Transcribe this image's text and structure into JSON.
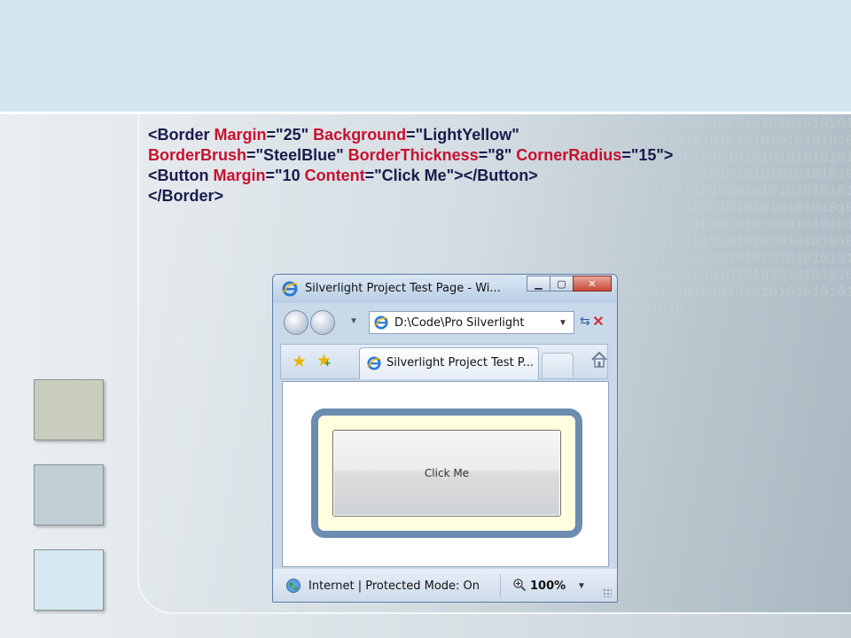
{
  "slide": {
    "binary_pattern": "1010101010101010101010101010101010101010101010101010101010101010101010101010101010101010101010101010101010101010101010101010101010101010101010101010101010101010101010101010101010101010101010101010101010101010101010101010101010101010101010101010101010101010101010101010101010101010101010101010101010101010101010101010101010101010101010101010101010101010"
  },
  "code": {
    "lines": [
      [
        {
          "t": "<Border ",
          "c": "kw"
        },
        {
          "t": "Margin",
          "c": "attr"
        },
        {
          "t": "=\"25\" ",
          "c": "val"
        },
        {
          "t": "Background",
          "c": "attr"
        },
        {
          "t": "=\"LightYellow\"",
          "c": "val"
        }
      ],
      [
        {
          "t": "BorderBrush",
          "c": "attr"
        },
        {
          "t": "=\"SteelBlue\" ",
          "c": "val"
        },
        {
          "t": "BorderThickness",
          "c": "attr"
        },
        {
          "t": "=\"8\" ",
          "c": "val"
        },
        {
          "t": "CornerRadius",
          "c": "attr"
        },
        {
          "t": "=\"15\">",
          "c": "val"
        }
      ],
      [
        {
          "t": "<Button ",
          "c": "kw"
        },
        {
          "t": "Margin",
          "c": "attr"
        },
        {
          "t": "=\"10 ",
          "c": "val"
        },
        {
          "t": "Content",
          "c": "attr"
        },
        {
          "t": "=\"Click Me\"></Button>",
          "c": "val"
        }
      ],
      [
        {
          "t": "</Border>",
          "c": "kw"
        }
      ]
    ]
  },
  "browser": {
    "title": "Silverlight Project Test Page - Wi...",
    "window_buttons": {
      "minimize": "▁",
      "maximize": "▢",
      "close": "✕"
    },
    "address": "D:\\Code\\Pro Silverlight",
    "tab_title": "Silverlight Project Test P...",
    "content_button": "Click Me",
    "status": "Internet | Protected Mode: On",
    "zoom": "100%"
  },
  "colors": {
    "border_brush": "#6c8cb0",
    "border_background": "#ffffe0",
    "code_attr": "#c8102e",
    "code_text": "#1a1a4a"
  }
}
